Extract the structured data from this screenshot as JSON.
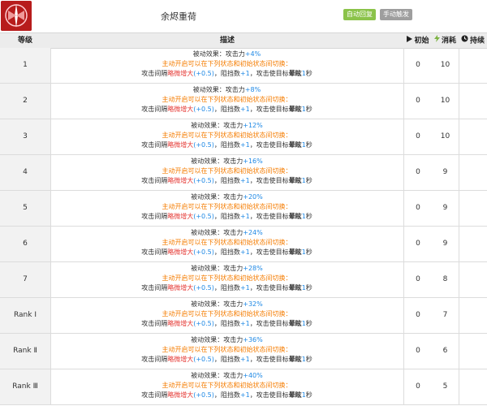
{
  "skill": {
    "name": "余烬重荷",
    "icon": "sword-emblem-icon",
    "tags": [
      "自动回复",
      "手动触发"
    ]
  },
  "table": {
    "headers": {
      "level": "等级",
      "desc": "描述",
      "init": "初始",
      "cost": "消耗",
      "duration": "持续"
    },
    "rows": [
      {
        "level": "1",
        "atk": "+4%",
        "init": "0",
        "cost": "10"
      },
      {
        "level": "2",
        "atk": "+8%",
        "init": "0",
        "cost": "10"
      },
      {
        "level": "3",
        "atk": "+12%",
        "init": "0",
        "cost": "10"
      },
      {
        "level": "4",
        "atk": "+16%",
        "init": "0",
        "cost": "9"
      },
      {
        "level": "5",
        "atk": "+20%",
        "init": "0",
        "cost": "9"
      },
      {
        "level": "6",
        "atk": "+24%",
        "init": "0",
        "cost": "9"
      },
      {
        "level": "7",
        "atk": "+28%",
        "init": "0",
        "cost": "8"
      },
      {
        "level": "Rank Ⅰ",
        "atk": "+32%",
        "init": "0",
        "cost": "7"
      },
      {
        "level": "Rank Ⅱ",
        "atk": "+36%",
        "init": "0",
        "cost": "6"
      },
      {
        "level": "Rank Ⅲ",
        "atk": "+40%",
        "init": "0",
        "cost": "5"
      }
    ],
    "desc": {
      "passive_prefix": "被动效果：攻击力",
      "active_line": "主动开启可以在下列状态和初始状态间切换：",
      "l3_a": "攻击间隔",
      "l3_b": "略微增大",
      "l3_c": "(+0.5)",
      "l3_d": "，阻挡数",
      "l3_e": "+1",
      "l3_f": "，攻击使目标",
      "l3_g": "晕眩",
      "l3_h": "1",
      "l3_i": "秒"
    }
  }
}
